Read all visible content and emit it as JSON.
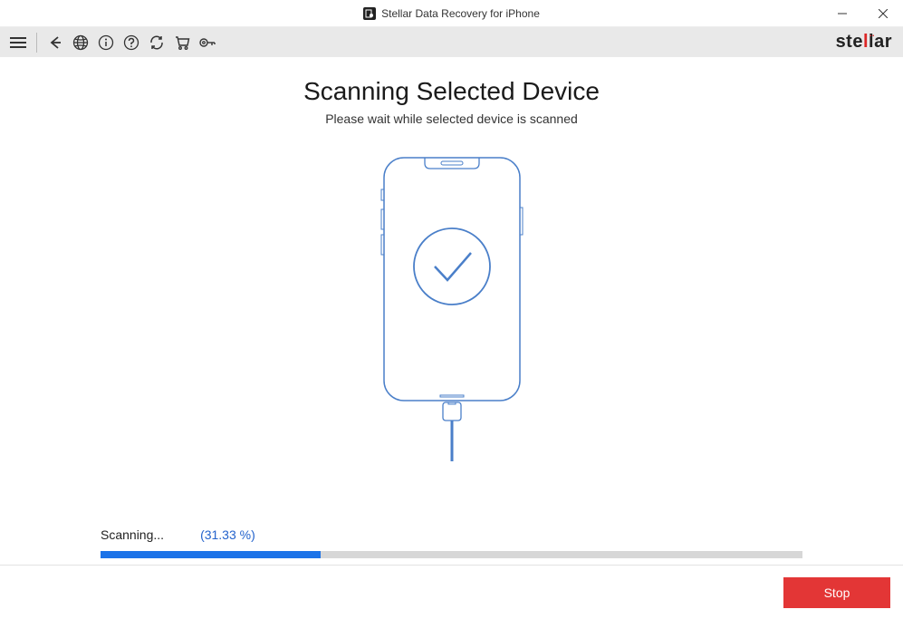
{
  "window": {
    "title": "Stellar Data Recovery for iPhone"
  },
  "brand": {
    "name": "stellar"
  },
  "main": {
    "title": "Scanning Selected Device",
    "subtitle": "Please wait while selected device is scanned"
  },
  "progress": {
    "status_label": "Scanning...",
    "percent_label": "(31.33 %)",
    "percent_value": 31.33
  },
  "footer": {
    "stop_label": "Stop"
  }
}
